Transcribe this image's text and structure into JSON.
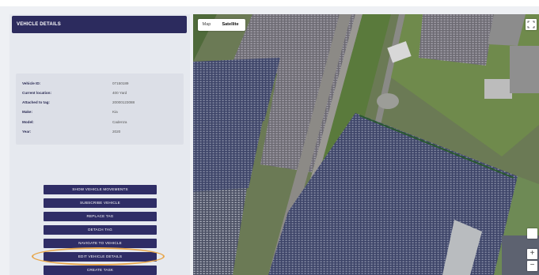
{
  "panel": {
    "title": "VEHICLE DETAILS"
  },
  "details": [
    {
      "label": "Vehicle ID:",
      "value": "07150189"
    },
    {
      "label": "Current location:",
      "value": "400 Yard"
    },
    {
      "label": "Attached to tag:",
      "value": "20000123088"
    },
    {
      "label": "Make:",
      "value": "Kia"
    },
    {
      "label": "Model:",
      "value": "Cadenza"
    },
    {
      "label": "Year:",
      "value": "2020"
    }
  ],
  "actions": [
    "SHOW VEHICLE MOVEMENTS",
    "SUBSCRIBE VEHICLE",
    "REPLACE TAG",
    "DETACH TAG",
    "NAVIGATE TO VEHICLE",
    "EDIT VEHICLE DETAILS",
    "CREATE TASK"
  ],
  "map": {
    "tabs": [
      "Map",
      "Satellite"
    ],
    "active_tab": "Satellite",
    "zoom_in": "+",
    "zoom_out": "−"
  },
  "colors": {
    "accent": "#2c2b5e",
    "highlight": "#e8a64a"
  }
}
